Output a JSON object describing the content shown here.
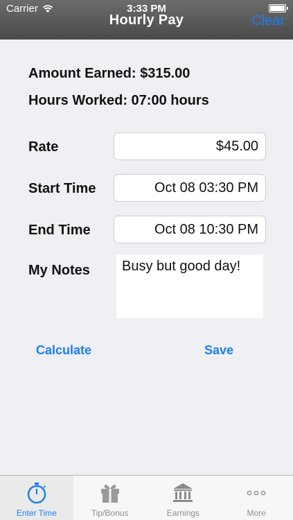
{
  "status_bar": {
    "carrier": "Carrier",
    "time": "3:33 PM"
  },
  "nav": {
    "title": "Hourly Pay",
    "clear_label": "Clear"
  },
  "summary": {
    "amount_earned": "Amount Earned: $315.00",
    "hours_worked": "Hours Worked: 07:00 hours"
  },
  "form": {
    "rate_label": "Rate",
    "rate_value": "$45.00",
    "start_label": "Start Time",
    "start_value": "Oct 08 03:30 PM",
    "end_label": "End Time",
    "end_value": "Oct 08 10:30 PM",
    "notes_label": "My Notes",
    "notes_value": "Busy but good day!"
  },
  "actions": {
    "calculate_label": "Calculate",
    "save_label": "Save"
  },
  "tabs": [
    {
      "label": "Enter Time",
      "icon": "stopwatch-icon",
      "active": true
    },
    {
      "label": "Tip/Bonus",
      "icon": "gift-icon",
      "active": false
    },
    {
      "label": "Earnings",
      "icon": "bank-icon",
      "active": false
    },
    {
      "label": "More",
      "icon": "more-dots-icon",
      "active": false
    }
  ],
  "colors": {
    "accent": "#1b7ef2",
    "navbar": "#555555",
    "background": "#efeff4",
    "inactive_tab": "#8e8e93"
  }
}
